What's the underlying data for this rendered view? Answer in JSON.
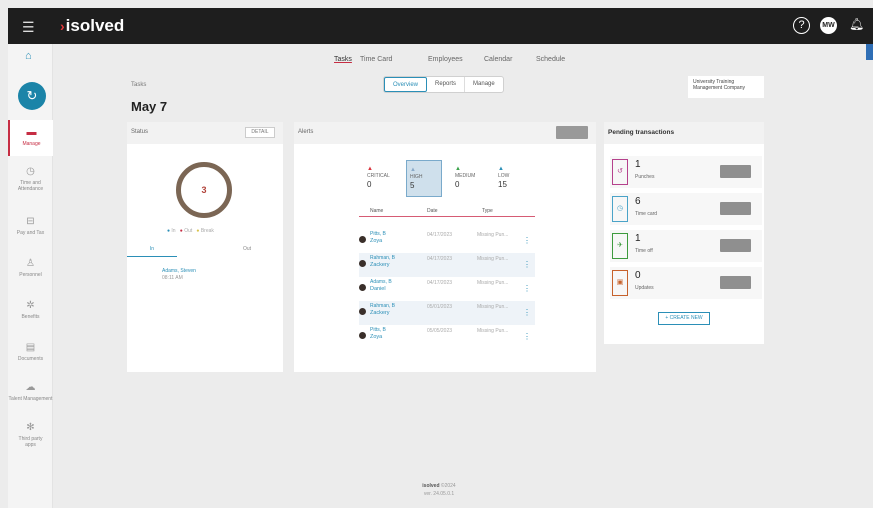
{
  "topbar": {
    "brand": "isolved",
    "brand_arrow": "›",
    "avatar_initials": "MW",
    "help_icon": "?",
    "bell_icon": "bell-icon"
  },
  "nav": [
    {
      "icon": "briefcase-icon",
      "glyph": "⌂",
      "label": "Manage"
    },
    {
      "icon": "clock-icon",
      "glyph": "◷",
      "label": "Time and Attendance"
    },
    {
      "icon": "money-icon",
      "glyph": "⊟",
      "label": "Pay and Tax"
    },
    {
      "icon": "person-icon",
      "glyph": "♙",
      "label": "Personnel"
    },
    {
      "icon": "benefits-icon",
      "glyph": "✲",
      "label": "Benefits"
    },
    {
      "icon": "documents-icon",
      "glyph": "▤",
      "label": "Documents"
    },
    {
      "icon": "cloud-icon",
      "glyph": "☁",
      "label": "Talent Management"
    },
    {
      "icon": "puzzle-icon",
      "glyph": "✻",
      "label": "Third party"
    }
  ],
  "nav_extra": "apps",
  "main_tabs": [
    "Tasks",
    "Time Card",
    "Employees",
    "Calendar",
    "Schedule"
  ],
  "breadcrumb": "Tasks",
  "page_title": "May 7",
  "view_tabs": [
    "Overview",
    "Reports",
    "Manage"
  ],
  "company": {
    "line1": "University Training",
    "line2": "Management Company"
  },
  "status": {
    "title": "Status",
    "detail": "DETAIL",
    "count": "3",
    "legend": [
      "In",
      "Out",
      "Break"
    ],
    "tabs": [
      "In",
      "Out"
    ],
    "punch_name": "Adams, Steven",
    "punch_time": "08:11 AM"
  },
  "alerts": {
    "title": "Alerts",
    "levels": [
      {
        "label": "CRITICAL",
        "count": "0",
        "color": "#d9343e"
      },
      {
        "label": "HIGH",
        "count": "5",
        "color": "#8aaac8"
      },
      {
        "label": "MEDIUM",
        "count": "0",
        "color": "#3aa34a"
      },
      {
        "label": "LOW",
        "count": "15",
        "color": "#2b8fb7"
      }
    ],
    "headers": [
      "Name",
      "Date",
      "Type"
    ],
    "rows": [
      {
        "last": "Pitts, B",
        "first": "Zoya",
        "date": "04/17/2023",
        "type": "Missing Pun..."
      },
      {
        "last": "Rahman, B",
        "first": "Zackery",
        "date": "04/17/2023",
        "type": "Missing Pun..."
      },
      {
        "last": "Adams, B",
        "first": "Daniel",
        "date": "04/17/2023",
        "type": "Missing Pun..."
      },
      {
        "last": "Rahman, B",
        "first": "Zackery",
        "date": "05/01/2023",
        "type": "Missing Pun..."
      },
      {
        "last": "Pitts, B",
        "first": "Zoya",
        "date": "05/05/2023",
        "type": "Missing Pun..."
      }
    ]
  },
  "pending": {
    "title": "Pending transactions",
    "items": [
      {
        "count": "1",
        "label": "Punches",
        "color": "#b5418c",
        "glyph": "↺"
      },
      {
        "count": "6",
        "label": "Time card",
        "color": "#4aa3c8",
        "glyph": "◷"
      },
      {
        "count": "1",
        "label": "Time off",
        "color": "#3d9a3d",
        "glyph": "✈"
      },
      {
        "count": "0",
        "label": "Updates",
        "color": "#c6612b",
        "glyph": "▣"
      }
    ],
    "create": "+ CREATE NEW"
  },
  "footer": {
    "brand": "isolved",
    "line1": "©2024",
    "line2": "ver. 24.05.0.1"
  }
}
